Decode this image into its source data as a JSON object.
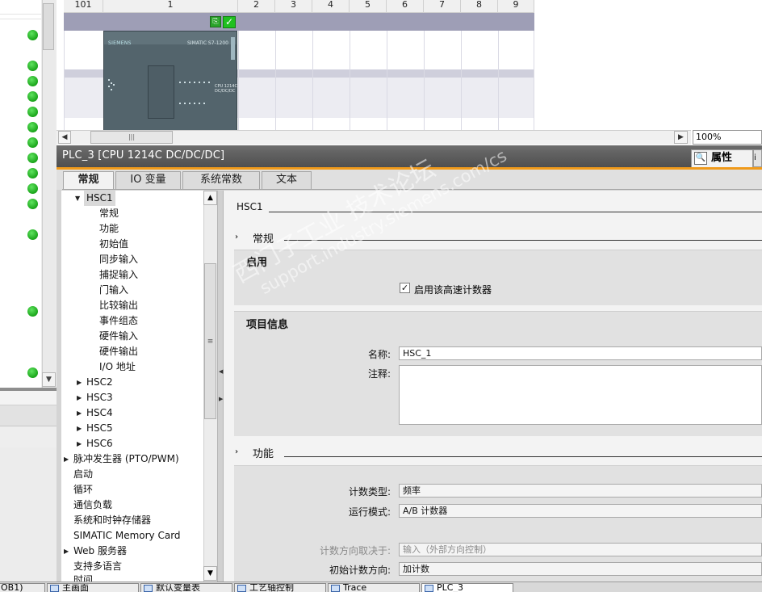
{
  "device_view": {
    "slot_headers": [
      "101",
      "1",
      "2",
      "3",
      "4",
      "5",
      "6",
      "7",
      "8",
      "9"
    ],
    "cpu": {
      "brand": "SIEMENS",
      "model": "SIMATIC S7-1200",
      "face_label": "CPU 1214C DC/DC/DC"
    },
    "zoom": "100%",
    "scroll_thumb_glyph": "|||"
  },
  "inspector": {
    "title": "PLC_3 [CPU 1214C DC/DC/DC]",
    "properties_tab": "属性",
    "tabs": [
      "常规",
      "IO 变量",
      "系统常数",
      "文本"
    ]
  },
  "tree": {
    "items": [
      {
        "label": "HSC1",
        "expanded": true,
        "selected": true
      },
      {
        "label": "常规"
      },
      {
        "label": "功能"
      },
      {
        "label": "初始值"
      },
      {
        "label": "同步输入"
      },
      {
        "label": "捕捉输入"
      },
      {
        "label": "门输入"
      },
      {
        "label": "比较输出"
      },
      {
        "label": "事件组态"
      },
      {
        "label": "硬件输入"
      },
      {
        "label": "硬件输出"
      },
      {
        "label": "I/O 地址"
      },
      {
        "label": "HSC2"
      },
      {
        "label": "HSC3"
      },
      {
        "label": "HSC4"
      },
      {
        "label": "HSC5"
      },
      {
        "label": "HSC6"
      },
      {
        "label": "脉冲发生器 (PTO/PWM)"
      },
      {
        "label": "启动"
      },
      {
        "label": "循环"
      },
      {
        "label": "通信负载"
      },
      {
        "label": "系统和时钟存储器"
      },
      {
        "label": "SIMATIC Memory Card"
      },
      {
        "label": "Web 服务器"
      },
      {
        "label": "支持多语言"
      },
      {
        "label": "时间"
      }
    ]
  },
  "content": {
    "header": "HSC1",
    "section_general": "常规",
    "enable_title": "启用",
    "enable_checkbox_label": "启用该高速计数器",
    "enable_checked": true,
    "project_info_title": "项目信息",
    "name_label": "名称:",
    "name_value": "HSC_1",
    "comment_label": "注释:",
    "comment_value": "",
    "section_function": "功能",
    "count_type_label": "计数类型:",
    "count_type_value": "频率",
    "operating_mode_label": "运行模式:",
    "operating_mode_value": "A/B 计数器",
    "count_direction_label": "计数方向取决于:",
    "count_direction_value": "输入（外部方向控制）",
    "initial_direction_label": "初始计数方向:",
    "initial_direction_value": "加计数"
  },
  "watermark": {
    "line1": "西门子工业 技术论坛",
    "line2": "support.industry.siemens.com/cs"
  },
  "taskbar": {
    "items": [
      "OB1)",
      "主画面",
      "默认变量表",
      "工艺轴控制",
      "Trace",
      "PLC_3"
    ]
  },
  "colors": {
    "accent_orange": "#f09a1a",
    "status_green": "#1aa51a",
    "rack_band": "#9e9eb6",
    "cpu_body": "#53646c"
  }
}
